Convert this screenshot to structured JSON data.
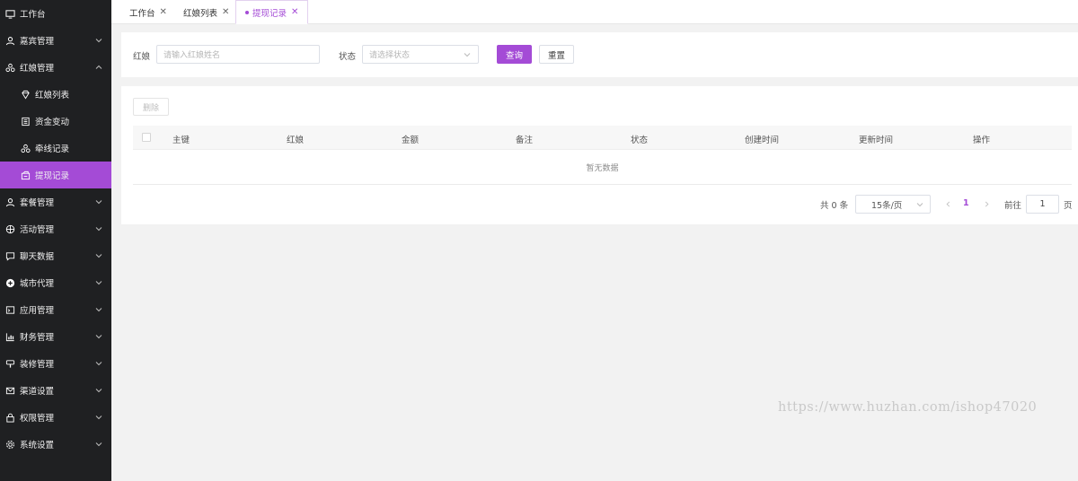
{
  "sidebar": {
    "items": [
      {
        "label": "工作台",
        "icon": "monitor-icon"
      },
      {
        "label": "嘉宾管理",
        "icon": "user-icon"
      },
      {
        "label": "红娘管理",
        "icon": "group-icon"
      },
      {
        "label": "红娘列表",
        "icon": "gem-icon"
      },
      {
        "label": "资金变动",
        "icon": "ledger-icon"
      },
      {
        "label": "牵线记录",
        "icon": "link-people-icon"
      },
      {
        "label": "提现记录",
        "icon": "wallet-icon"
      },
      {
        "label": "套餐管理",
        "icon": "user-icon"
      },
      {
        "label": "活动管理",
        "icon": "basketball-icon"
      },
      {
        "label": "聊天数据",
        "icon": "chat-icon"
      },
      {
        "label": "城市代理",
        "icon": "add-circle-icon"
      },
      {
        "label": "应用管理",
        "icon": "app-icon"
      },
      {
        "label": "财务管理",
        "icon": "chart-icon"
      },
      {
        "label": "装修管理",
        "icon": "brush-icon"
      },
      {
        "label": "渠道设置",
        "icon": "mail-icon"
      },
      {
        "label": "权限管理",
        "icon": "lock-icon"
      },
      {
        "label": "系统设置",
        "icon": "gear-icon"
      }
    ]
  },
  "tabs": [
    {
      "label": "工作台",
      "close": "✕"
    },
    {
      "label": "红娘列表",
      "close": "✕"
    },
    {
      "label": "提现记录",
      "close": "✕"
    }
  ],
  "search": {
    "matchmaker_label": "红娘",
    "matchmaker_placeholder": "请输入红娘姓名",
    "status_label": "状态",
    "status_placeholder": "请选择状态",
    "query_button": "查询",
    "reset_button": "重置"
  },
  "table": {
    "delete_button": "删除",
    "columns": [
      "主键",
      "红娘",
      "金额",
      "备注",
      "状态",
      "创建时间",
      "更新时间",
      "操作"
    ],
    "empty_text": "暂无数据"
  },
  "pagination": {
    "total_text": "共 0 条",
    "page_size": "15条/页",
    "current_page": "1",
    "goto_label": "前往",
    "goto_value": "1",
    "page_suffix": "页"
  },
  "watermark": "https://www.huzhan.com/ishop47020",
  "colors": {
    "accent": "#a44bd6",
    "sidebar_bg": "#1f2022"
  }
}
